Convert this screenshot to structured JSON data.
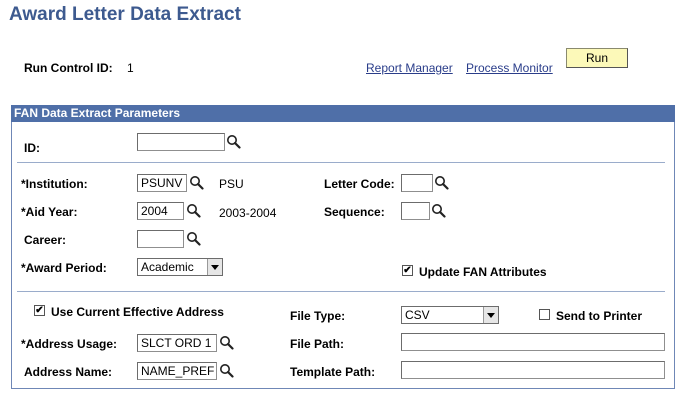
{
  "page": {
    "title": "Award Letter Data Extract"
  },
  "run_control": {
    "label": "Run Control ID:",
    "value": "1",
    "report_manager": "Report Manager",
    "process_monitor": "Process Monitor",
    "run_label": "Run"
  },
  "panel": {
    "title": "FAN Data Extract Parameters",
    "id": {
      "label": "ID:",
      "value": ""
    },
    "institution": {
      "label": "*Institution:",
      "value": "PSUNV",
      "desc": "PSU"
    },
    "aid_year": {
      "label": "*Aid Year:",
      "value": "2004",
      "desc": "2003-2004"
    },
    "career": {
      "label": "Career:",
      "value": ""
    },
    "award_period": {
      "label": "*Award Period:",
      "value": "Academic"
    },
    "letter_code": {
      "label": "Letter Code:",
      "value": ""
    },
    "sequence": {
      "label": "Sequence:",
      "value": ""
    },
    "update_fan": {
      "label": "Update FAN Attributes",
      "checked": true
    },
    "use_current_address": {
      "label": "Use Current Effective Address",
      "checked": true
    },
    "address_usage": {
      "label": "*Address Usage:",
      "value": "SLCT ORD 1"
    },
    "address_name": {
      "label": "Address Name:",
      "value": "NAME_PREF"
    },
    "file_type": {
      "label": "File Type:",
      "value": "CSV"
    },
    "send_to_printer": {
      "label": "Send to Printer",
      "checked": false
    },
    "file_path": {
      "label": "File Path:",
      "value": ""
    },
    "template_path": {
      "label": "Template Path:",
      "value": ""
    }
  },
  "icons": {
    "lookup": "magnifier-lookup-icon"
  },
  "colors": {
    "title": "#3d5a8f",
    "panel_header": "#4f6fa8",
    "run_button": "#fcf9b9",
    "link": "#2a3d8a"
  }
}
